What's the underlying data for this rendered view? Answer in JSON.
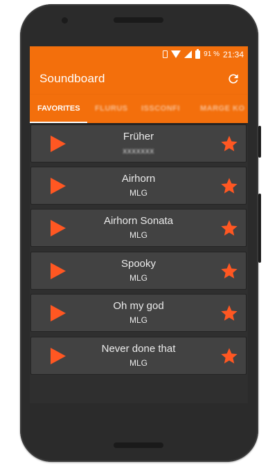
{
  "status_bar": {
    "battery_percent": "91 %",
    "time": "21:34",
    "icons": [
      "vibrate-icon",
      "wifi-icon",
      "signal-icon",
      "battery-icon"
    ]
  },
  "app_bar": {
    "title": "Soundboard",
    "action_icon": "refresh-icon"
  },
  "tabs": [
    {
      "label": "FAVORITES",
      "selected": true
    },
    {
      "label": "FLURUS",
      "selected": false
    },
    {
      "label": "ISSCONFI",
      "selected": false
    },
    {
      "label": "MARGE KO",
      "selected": false
    }
  ],
  "sounds": [
    {
      "name": "Früher",
      "category": "xxxxxxx",
      "favorite": true
    },
    {
      "name": "Airhorn",
      "category": "MLG",
      "favorite": true
    },
    {
      "name": "Airhorn Sonata",
      "category": "MLG",
      "favorite": true
    },
    {
      "name": "Spooky",
      "category": "MLG",
      "favorite": true
    },
    {
      "name": "Oh my god",
      "category": "MLG",
      "favorite": true
    },
    {
      "name": "Never done that",
      "category": "MLG",
      "favorite": true
    }
  ],
  "colors": {
    "accent": "#f36f0c",
    "play": "#ff5722",
    "star": "#ff5722",
    "row_bg": "#424242",
    "list_bg": "#2f2f2f"
  }
}
